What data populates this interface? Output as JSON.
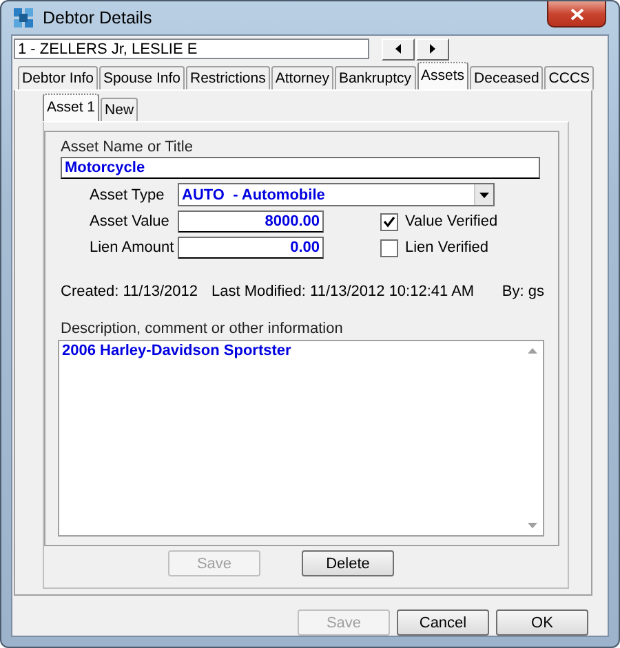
{
  "window": {
    "title": "Debtor Details"
  },
  "debtor_selector": {
    "value": "1 - ZELLERS Jr, LESLIE E"
  },
  "tabs": [
    {
      "label": "Debtor Info",
      "selected": false
    },
    {
      "label": "Spouse Info",
      "selected": false
    },
    {
      "label": "Restrictions",
      "selected": false
    },
    {
      "label": "Attorney",
      "selected": false
    },
    {
      "label": "Bankruptcy",
      "selected": false
    },
    {
      "label": "Assets",
      "selected": true
    },
    {
      "label": "Deceased",
      "selected": false
    },
    {
      "label": "CCCS",
      "selected": false
    }
  ],
  "asset_tabs": [
    {
      "label": "Asset 1",
      "selected": true
    },
    {
      "label": "New",
      "selected": false
    }
  ],
  "asset_name": {
    "label": "Asset Name or Title",
    "value": "Motorcycle"
  },
  "asset_type": {
    "label": "Asset Type",
    "value": "AUTO  - Automobile"
  },
  "asset_value": {
    "label": "Asset Value",
    "value": "8000.00"
  },
  "lien_amount": {
    "label": "Lien Amount",
    "value": "0.00"
  },
  "checkboxes": [
    {
      "label": "Value Verified",
      "checked": true
    },
    {
      "label": "Lien Verified",
      "checked": false
    }
  ],
  "created": "Created: 11/13/2012",
  "last_modified": "Last Modified: 11/13/2012 10:12:41 AM",
  "by": "By: gs",
  "description": {
    "label": "Description, comment or other information",
    "value": "2006 Harley-Davidson Sportster"
  },
  "asset_buttons": [
    {
      "label": "Save",
      "disabled": true
    },
    {
      "label": "Delete",
      "disabled": false
    }
  ],
  "dialog_buttons": [
    {
      "label": "Save",
      "disabled": true
    },
    {
      "label": "Cancel",
      "disabled": false
    },
    {
      "label": "OK",
      "disabled": false
    }
  ]
}
